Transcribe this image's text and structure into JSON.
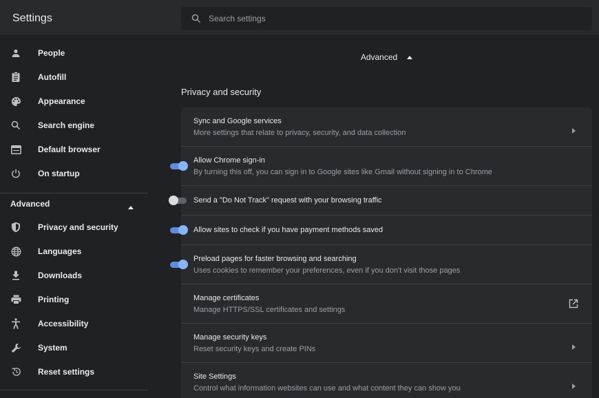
{
  "app": {
    "title": "Settings"
  },
  "search": {
    "placeholder": "Search settings"
  },
  "sidebar": {
    "items": [
      {
        "label": "People",
        "icon": "person-icon"
      },
      {
        "label": "Autofill",
        "icon": "clipboard-icon"
      },
      {
        "label": "Appearance",
        "icon": "palette-icon"
      },
      {
        "label": "Search engine",
        "icon": "search-icon"
      },
      {
        "label": "Default browser",
        "icon": "browser-window-icon"
      },
      {
        "label": "On startup",
        "icon": "power-icon"
      }
    ],
    "advanced_label": "Advanced",
    "advanced_items": [
      {
        "label": "Privacy and security",
        "icon": "shield-icon"
      },
      {
        "label": "Languages",
        "icon": "globe-icon"
      },
      {
        "label": "Downloads",
        "icon": "download-icon"
      },
      {
        "label": "Printing",
        "icon": "printer-icon"
      },
      {
        "label": "Accessibility",
        "icon": "accessibility-icon"
      },
      {
        "label": "System",
        "icon": "wrench-icon"
      },
      {
        "label": "Reset settings",
        "icon": "restore-icon"
      }
    ]
  },
  "main": {
    "advanced_label": "Advanced",
    "section_title": "Privacy and security",
    "rows": [
      {
        "title": "Sync and Google services",
        "subtitle": "More settings that relate to privacy, security, and data collection",
        "control": "arrow"
      },
      {
        "title": "Allow Chrome sign-in",
        "subtitle": "By turning this off, you can sign in to Google sites like Gmail without signing in to Chrome",
        "control": "toggle",
        "enabled": true
      },
      {
        "title": "Send a \"Do Not Track\" request with your browsing traffic",
        "subtitle": "",
        "control": "toggle",
        "enabled": false
      },
      {
        "title": "Allow sites to check if you have payment methods saved",
        "subtitle": "",
        "control": "toggle",
        "enabled": true
      },
      {
        "title": "Preload pages for faster browsing and searching",
        "subtitle": "Uses cookies to remember your preferences, even if you don't visit those pages",
        "control": "toggle",
        "enabled": true
      },
      {
        "title": "Manage certificates",
        "subtitle": "Manage HTTPS/SSL certificates and settings",
        "control": "external-link"
      },
      {
        "title": "Manage security keys",
        "subtitle": "Reset security keys and create PINs",
        "control": "arrow"
      },
      {
        "title": "Site Settings",
        "subtitle": "Control what information websites can use and what content they can show you",
        "control": "arrow"
      }
    ]
  },
  "colors": {
    "background": "#202124",
    "surface": "#292a2d",
    "accent": "#8ab4f8",
    "text_primary": "#e8eaed",
    "text_secondary": "#9aa0a6"
  }
}
